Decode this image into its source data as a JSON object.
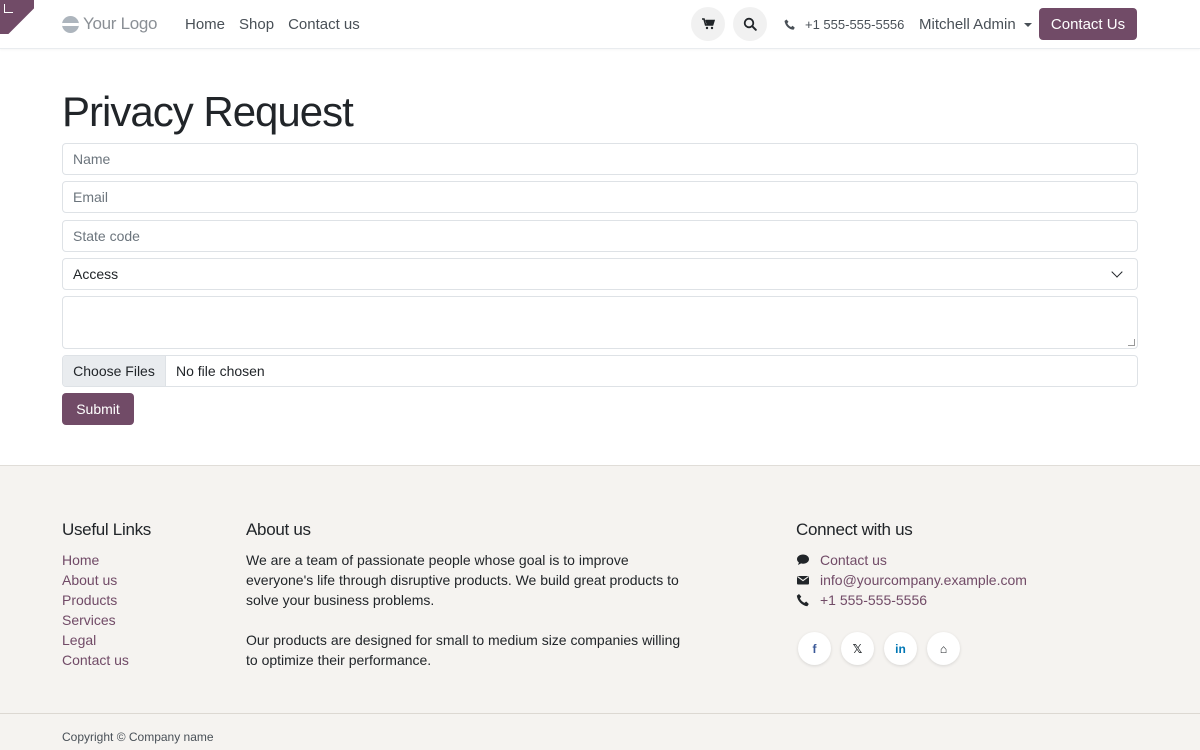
{
  "header": {
    "logo_text": "Your Logo",
    "nav": [
      "Home",
      "Shop",
      "Contact us"
    ],
    "phone": "+1 555-555-5556",
    "user": "Mitchell Admin",
    "cta": "Contact Us"
  },
  "form": {
    "title": "Privacy Request",
    "name_placeholder": "Name",
    "email_placeholder": "Email",
    "state_placeholder": "State code",
    "request_type": "Access",
    "file_button": "Choose Files",
    "file_status": "No file chosen",
    "submit": "Submit"
  },
  "footer": {
    "useful_links_title": "Useful Links",
    "useful_links": [
      "Home",
      "About us",
      "Products",
      "Services",
      "Legal",
      "Contact us"
    ],
    "about_title": "About us",
    "about_p1": "We are a team of passionate people whose goal is to improve everyone's life through disruptive products. We build great products to solve your business problems.",
    "about_p2": "Our products are designed for small to medium size companies willing to optimize their performance.",
    "connect_title": "Connect with us",
    "connect_contact": "Contact us",
    "connect_email": "info@yourcompany.example.com",
    "connect_phone": "+1 555-555-5556",
    "socials": [
      {
        "icon": "facebook-icon",
        "glyph": "f",
        "color": "#3b5998"
      },
      {
        "icon": "x-twitter-icon",
        "glyph": "𝕏",
        "color": "#212529"
      },
      {
        "icon": "linkedin-icon",
        "glyph": "in",
        "color": "#0077b5"
      },
      {
        "icon": "home-icon",
        "glyph": "⌂",
        "color": "#212529"
      }
    ],
    "copyright": "Copyright © Company name"
  },
  "colors": {
    "brand": "#714b67",
    "footer_bg": "#f5f3f0"
  }
}
